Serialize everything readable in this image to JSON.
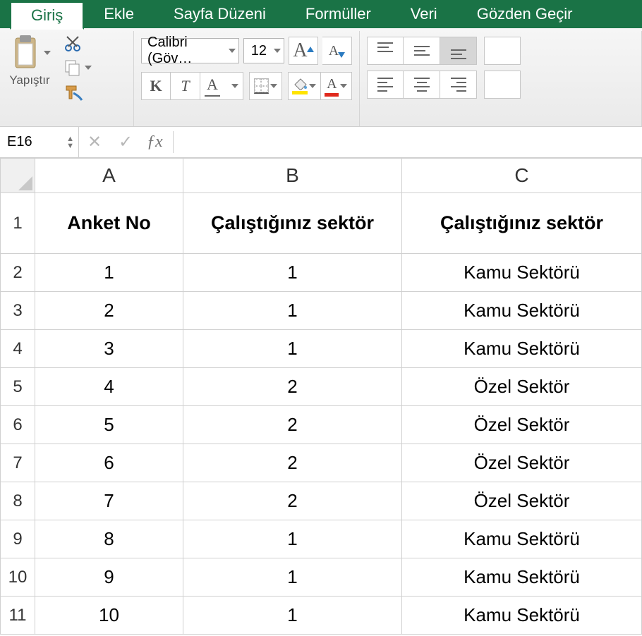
{
  "tabs": [
    "Giriş",
    "Ekle",
    "Sayfa Düzeni",
    "Formüller",
    "Veri",
    "Gözden Geçir"
  ],
  "active_tab": "Giriş",
  "clipboard": {
    "paste_label": "Yapıştır"
  },
  "font": {
    "name": "Calibri (Göv…",
    "size": "12"
  },
  "namebox": "E16",
  "columns": [
    "A",
    "B",
    "C"
  ],
  "rows": [
    "1",
    "2",
    "3",
    "4",
    "5",
    "6",
    "7",
    "8",
    "9",
    "10",
    "11"
  ],
  "headers": {
    "A": "Anket No",
    "B": "Çalıştığınız sektör",
    "C": "Çalıştığınız sektör"
  },
  "data": [
    {
      "a": "1",
      "b": "1",
      "c": "Kamu Sektörü"
    },
    {
      "a": "2",
      "b": "1",
      "c": "Kamu Sektörü"
    },
    {
      "a": "3",
      "b": "1",
      "c": "Kamu Sektörü"
    },
    {
      "a": "4",
      "b": "2",
      "c": "Özel Sektör"
    },
    {
      "a": "5",
      "b": "2",
      "c": "Özel Sektör"
    },
    {
      "a": "6",
      "b": "2",
      "c": "Özel Sektör"
    },
    {
      "a": "7",
      "b": "2",
      "c": "Özel Sektör"
    },
    {
      "a": "8",
      "b": "1",
      "c": "Kamu Sektörü"
    },
    {
      "a": "9",
      "b": "1",
      "c": "Kamu Sektörü"
    },
    {
      "a": "10",
      "b": "1",
      "c": "Kamu Sektörü"
    }
  ],
  "formula_fx": "ƒx"
}
